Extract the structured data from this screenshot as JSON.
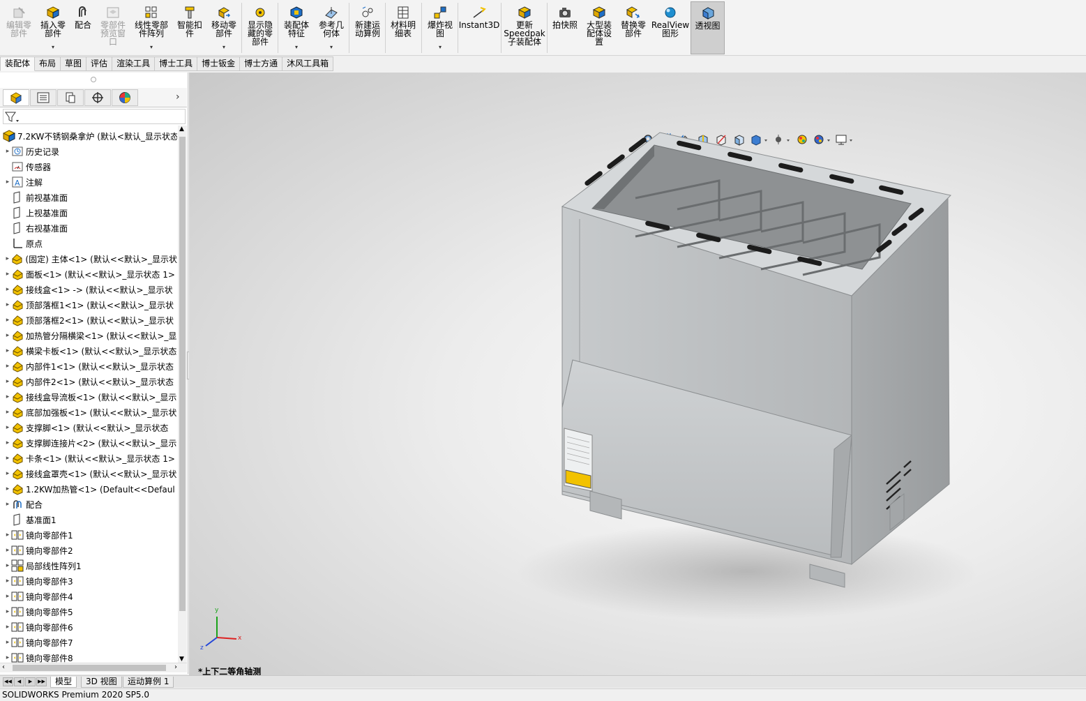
{
  "ribbon": {
    "buttons": [
      {
        "label": "编辑零\n部件",
        "icon": "edit-component-icon",
        "disabled": true
      },
      {
        "label": "插入零\n部件",
        "icon": "insert-component-icon",
        "dropdown": true
      },
      {
        "label": "配合",
        "icon": "mate-icon"
      },
      {
        "label": "零部件\n预览窗\n口",
        "icon": "component-preview-icon",
        "disabled": true
      },
      {
        "label": "线性零部\n件阵列",
        "icon": "linear-pattern-icon",
        "dropdown": true
      },
      {
        "label": "智能扣\n件",
        "icon": "smart-fastener-icon"
      },
      {
        "label": "移动零\n部件",
        "icon": "move-component-icon",
        "dropdown": true
      },
      {
        "label": "显示隐\n藏的零\n部件",
        "icon": "show-hidden-icon"
      },
      {
        "label": "装配体\n特征",
        "icon": "assembly-feature-icon",
        "dropdown": true
      },
      {
        "label": "参考几\n何体",
        "icon": "reference-geometry-icon",
        "dropdown": true
      },
      {
        "label": "新建运\n动算例",
        "icon": "motion-study-icon"
      },
      {
        "label": "材料明\n细表",
        "icon": "bom-icon"
      },
      {
        "label": "爆炸视\n图",
        "icon": "exploded-view-icon",
        "dropdown": true
      },
      {
        "label": "Instant3D",
        "icon": "instant3d-icon"
      },
      {
        "label": "更新\nSpeedpak\n子装配体",
        "icon": "speedpak-icon"
      },
      {
        "label": "拍快照",
        "icon": "snapshot-icon"
      },
      {
        "label": "大型装\n配体设\n置",
        "icon": "large-assembly-icon"
      },
      {
        "label": "替换零\n部件",
        "icon": "replace-component-icon"
      },
      {
        "label": "RealView\n图形",
        "icon": "realview-icon"
      },
      {
        "label": "透视图",
        "icon": "perspective-icon",
        "active": true
      }
    ]
  },
  "command_tabs": [
    "装配体",
    "布局",
    "草图",
    "评估",
    "渲染工具",
    "博士工具",
    "博士钣金",
    "博士方通",
    "沐风工具箱"
  ],
  "active_command_tab": "装配体",
  "tree": {
    "root": "7.2KW不锈钢桑拿炉 (默认<默认_显示状态",
    "items": [
      {
        "label": "历史记录",
        "icon": "history-icon",
        "expandable": true
      },
      {
        "label": "传感器",
        "icon": "sensor-icon",
        "expandable": false
      },
      {
        "label": "注解",
        "icon": "annotation-icon",
        "expandable": true
      },
      {
        "label": "前视基准面",
        "icon": "plane-icon",
        "expandable": false
      },
      {
        "label": "上视基准面",
        "icon": "plane-icon",
        "expandable": false
      },
      {
        "label": "右视基准面",
        "icon": "plane-icon",
        "expandable": false
      },
      {
        "label": "原点",
        "icon": "origin-icon",
        "expandable": false
      },
      {
        "label": "(固定) 主体<1> (默认<<默认>_显示状",
        "icon": "part-icon",
        "expandable": true
      },
      {
        "label": "面板<1> (默认<<默认>_显示状态 1>",
        "icon": "part-icon",
        "expandable": true
      },
      {
        "label": "接线盒<1> -> (默认<<默认>_显示状",
        "icon": "part-icon",
        "expandable": true
      },
      {
        "label": "顶部落框1<1> (默认<<默认>_显示状",
        "icon": "part-icon",
        "expandable": true
      },
      {
        "label": "顶部落框2<1> (默认<<默认>_显示状",
        "icon": "part-icon",
        "expandable": true
      },
      {
        "label": "加热管分隔横梁<1> (默认<<默认>_显",
        "icon": "part-icon",
        "expandable": true
      },
      {
        "label": "横梁卡板<1> (默认<<默认>_显示状态",
        "icon": "part-icon",
        "expandable": true
      },
      {
        "label": "内部件1<1> (默认<<默认>_显示状态",
        "icon": "part-icon",
        "expandable": true
      },
      {
        "label": "内部件2<1> (默认<<默认>_显示状态",
        "icon": "part-icon",
        "expandable": true
      },
      {
        "label": "接线盒导流板<1> (默认<<默认>_显示",
        "icon": "part-icon",
        "expandable": true
      },
      {
        "label": "底部加强板<1> (默认<<默认>_显示状",
        "icon": "part-icon",
        "expandable": true
      },
      {
        "label": "支撑脚<1> (默认<<默认>_显示状态",
        "icon": "part-icon",
        "expandable": true
      },
      {
        "label": "支撑脚连接片<2> (默认<<默认>_显示",
        "icon": "part-icon",
        "expandable": true
      },
      {
        "label": "卡条<1> (默认<<默认>_显示状态 1>",
        "icon": "part-icon",
        "expandable": true
      },
      {
        "label": "接线盒罩壳<1> (默认<<默认>_显示状",
        "icon": "part-icon",
        "expandable": true
      },
      {
        "label": "1.2KW加热管<1> (Default<<Defaul",
        "icon": "part-icon",
        "expandable": true
      },
      {
        "label": "配合",
        "icon": "mates-folder-icon",
        "expandable": true
      },
      {
        "label": "基准面1",
        "icon": "plane-icon",
        "expandable": false
      },
      {
        "label": "镜向零部件1",
        "icon": "mirror-component-icon",
        "expandable": true
      },
      {
        "label": "镜向零部件2",
        "icon": "mirror-component-icon",
        "expandable": true
      },
      {
        "label": "局部线性阵列1",
        "icon": "local-pattern-icon",
        "expandable": true
      },
      {
        "label": "镜向零部件3",
        "icon": "mirror-component-icon",
        "expandable": true
      },
      {
        "label": "镜向零部件4",
        "icon": "mirror-component-icon",
        "expandable": true
      },
      {
        "label": "镜向零部件5",
        "icon": "mirror-component-icon",
        "expandable": true
      },
      {
        "label": "镜向零部件6",
        "icon": "mirror-component-icon",
        "expandable": true
      },
      {
        "label": "镜向零部件7",
        "icon": "mirror-component-icon",
        "expandable": true
      },
      {
        "label": "镜向零部件8",
        "icon": "mirror-component-icon",
        "expandable": true
      }
    ]
  },
  "viewport": {
    "view_name": "*上下二等角轴测",
    "triad": {
      "x": "x",
      "y": "y",
      "z": "z"
    }
  },
  "bottom_tabs": [
    "模型",
    "3D 视图",
    "运动算例 1"
  ],
  "status_text": "SOLIDWORKS Premium 2020 SP5.0",
  "colors": {
    "accent_yellow": "#f2c200",
    "accent_blue": "#1f6fc6",
    "steel": "#b8bcbe"
  }
}
